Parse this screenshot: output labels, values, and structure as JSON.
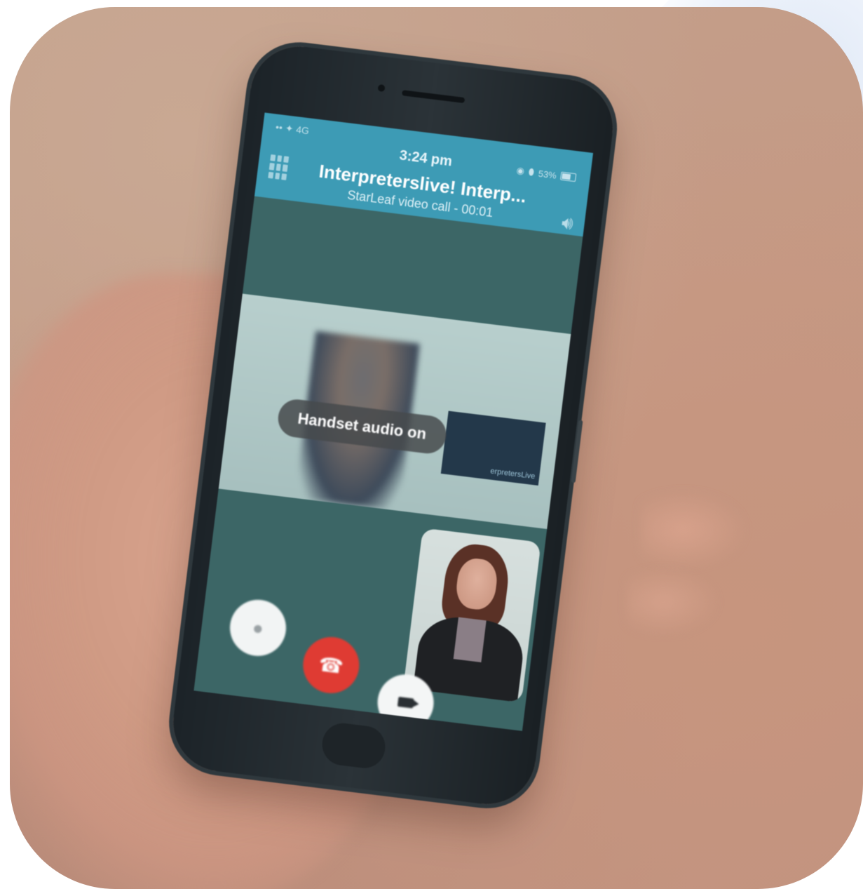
{
  "status_bar": {
    "carrier": "•• ✦ 4G",
    "time": "3:24 pm",
    "battery": "53%"
  },
  "call": {
    "title": "Interpreterslive! Interp...",
    "subtitle": "StarLeaf video call - 00:01"
  },
  "toast": {
    "text": "Handset audio on"
  },
  "remote_video": {
    "screen_label": "erpretersLive"
  },
  "controls": {
    "mute_icon": "microphone-icon",
    "end_icon": "hang-up-icon",
    "video_icon": "video-camera-icon"
  },
  "colors": {
    "header": "#3d9bb5",
    "call_background": "#3c6666",
    "end_call": "#df3b33"
  }
}
